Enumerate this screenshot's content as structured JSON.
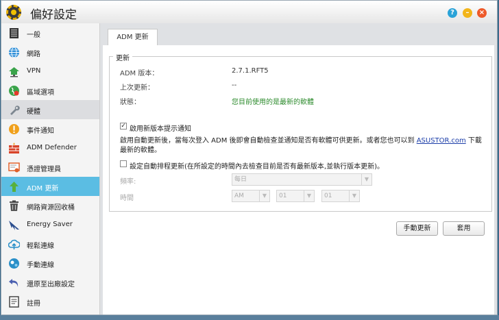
{
  "window": {
    "title": "偏好設定"
  },
  "titlebar_buttons": {
    "help": "?",
    "minimize": "–",
    "close": "×"
  },
  "sidebar": {
    "items": [
      {
        "label": "一般",
        "icon": "server-icon"
      },
      {
        "label": "網路",
        "icon": "globe-icon"
      },
      {
        "label": "VPN",
        "icon": "vpn-network-icon"
      },
      {
        "label": "區域選項",
        "icon": "globe-location-icon"
      },
      {
        "label": "硬體",
        "icon": "wrench-icon"
      },
      {
        "label": "事件通知",
        "icon": "alert-icon"
      },
      {
        "label": "ADM Defender",
        "icon": "firewall-icon"
      },
      {
        "label": "憑證管理員",
        "icon": "certificate-icon"
      },
      {
        "label": "ADM 更新",
        "icon": "update-arrow-icon"
      },
      {
        "label": "網路資源回收桶",
        "icon": "recycle-bin-icon"
      },
      {
        "label": "Energy Saver",
        "icon": "energy-saver-icon"
      },
      {
        "label": "輕鬆連線",
        "icon": "cloud-connect-icon"
      },
      {
        "label": "手動連線",
        "icon": "manual-connect-icon"
      },
      {
        "label": "還原至出廠設定",
        "icon": "restore-icon"
      },
      {
        "label": "註冊",
        "icon": "register-icon"
      }
    ],
    "active_index": 8,
    "hover_index": 4
  },
  "tab": {
    "label": "ADM 更新"
  },
  "update": {
    "legend": "更新",
    "version_label": "ADM 版本：",
    "version_value": "2.7.1.RFT5",
    "last_update_label": "上次更新：",
    "last_update_value": "--",
    "status_label": "狀態：",
    "status_value": "您目前使用的是最新的軟體",
    "notify_checkbox_label": "啟用新版本提示通知",
    "notify_checked": true,
    "description_text": "啟用自動更新後，當每次登入 ADM 後即會自動檢查並通知是否有軟體可供更新。或者您也可以到 ",
    "description_link": "ASUSTOR.com",
    "description_tail": " 下載最新的軟體。",
    "auto_checkbox_label": "設定自動排程更新(在所設定的時間內去檢查目前是否有最新版本,並執行版本更新)。",
    "auto_checked": false,
    "frequency_label": "頻率:",
    "frequency_value": "每日",
    "time_label": "時間",
    "time_ampm": "AM",
    "time_hour": "01",
    "time_minute": "01"
  },
  "buttons": {
    "manual_update": "手動更新",
    "apply": "套用"
  }
}
